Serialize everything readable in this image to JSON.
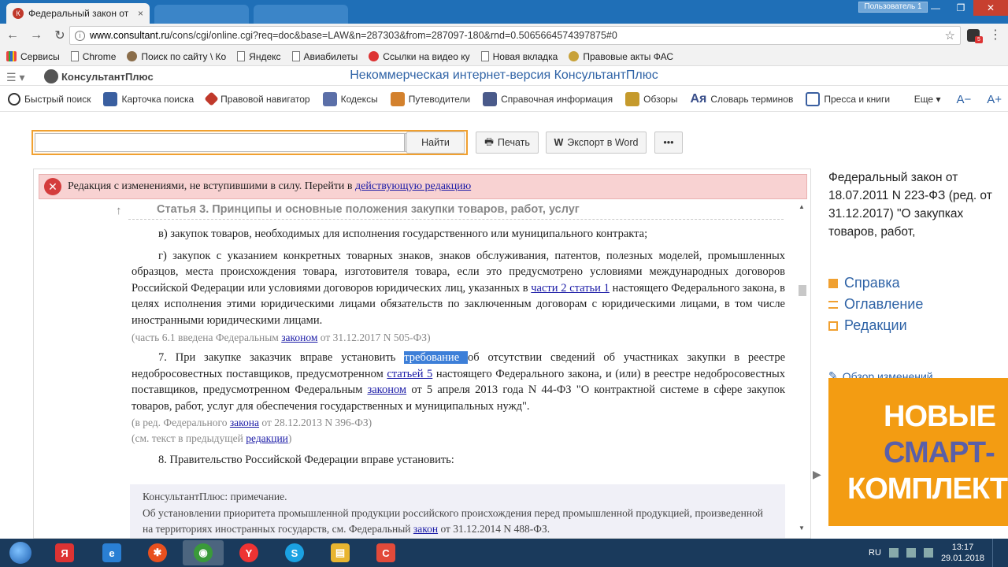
{
  "browser": {
    "tab_title": "Федеральный закон от",
    "tab_close": "×",
    "user_label": "Пользователь 1",
    "url_prefix": "www.consultant.ru",
    "url_rest": "/cons/cgi/online.cgi?req=doc&base=LAW&n=287303&from=287097-180&rnd=0.5065664574397875#0",
    "ext_badge": "5",
    "window_buttons": {
      "minimize": "—",
      "maximize": "❐",
      "close": "✕"
    }
  },
  "bookmarks": [
    {
      "label": "Сервисы",
      "icon": "apps-icon"
    },
    {
      "label": "Chrome",
      "icon": "page-icon"
    },
    {
      "label": "Поиск по сайту \\ Ко",
      "icon": "globe-icon"
    },
    {
      "label": "Яндекс",
      "icon": "page-icon"
    },
    {
      "label": "Авиабилеты",
      "icon": "page-icon"
    },
    {
      "label": "Ссылки на видео ку",
      "icon": "flower-icon"
    },
    {
      "label": "Новая вкладка",
      "icon": "page-icon"
    },
    {
      "label": "Правовые акты ФАС",
      "icon": "fas-icon"
    }
  ],
  "header": {
    "logo_text": "КонсультантПлюс",
    "site_title": "Некоммерческая интернет-версия КонсультантПлюс"
  },
  "nav": {
    "items": [
      "Быстрый поиск",
      "Карточка поиска",
      "Правовой навигатор",
      "Кодексы",
      "Путеводители",
      "Справочная информация",
      "Обзоры",
      "Словарь терминов",
      "Пресса и книги"
    ],
    "dict_icon": "Ая",
    "more": "Еще ▾",
    "font_smaller": "A−",
    "font_larger": "A+"
  },
  "search": {
    "placeholder": "",
    "find_button": "Найти",
    "print_button": "Печать",
    "export_button": "Экспорт в Word",
    "more_button": "•••"
  },
  "document": {
    "warning_text": "Редакция с изменениями, не вступившими в силу. Перейти в ",
    "warning_link": "действующую редакцию",
    "article_heading": "Статья 3. Принципы и основные положения закупки товаров, работ, услуг",
    "p_v": "в) закупок товаров, необходимых для исполнения государственного или муниципального контракта;",
    "p_g_1": "г) закупок с указанием конкретных товарных знаков, знаков обслуживания, патентов, полезных моделей, промышленных образцов, места происхождения товара, изготовителя товара, если это предусмотрено условиями международных договоров Российской Федерации или условиями договоров юридических лиц, указанных в ",
    "p_g_link": "части 2 статьи 1",
    "p_g_2": " настоящего Федерального закона, в целях исполнения этими юридическими лицами обязательств по заключенным договорам с юридическими лицами, в том числе иностранными юридическими лицами.",
    "note_61_pre": "(часть 6.1 введена Федеральным ",
    "note_61_link": "законом",
    "note_61_post": " от 31.12.2017 N 505-ФЗ)",
    "p7_pre": "7. При закупке заказчик вправе установить ",
    "p7_hl": "требование ",
    "p7_mid": "об отсутствии сведений об участниках закупки в реестре недобросовестных поставщиков, предусмотренном ",
    "p7_link1": "статьей 5",
    "p7_mid2": " настоящего Федерального закона, и (или) в реестре недобросовестных поставщиков, предусмотренном Федеральным ",
    "p7_link2": "законом",
    "p7_post": " от 5 апреля 2013 года N 44-ФЗ \"О контрактной системе в сфере закупок товаров, работ, услуг для обеспечения государственных и муниципальных нужд\".",
    "note_red_pre": "(в ред. Федерального ",
    "note_red_link": "закона",
    "note_red_post": " от 28.12.2013 N 396-ФЗ)",
    "note_prev_pre": "(см. текст в предыдущей ",
    "note_prev_link": "редакции",
    "note_prev_post": ")",
    "p8": "8. Правительство Российской Федерации вправе установить:",
    "cp_note_title": "КонсультантПлюс: примечание.",
    "cp_note_1": "Об установлении приоритета промышленной продукции российского происхождения перед промышленной продукцией, произведенной на территориях иностранных государств, см. Федеральный ",
    "cp_note_link": "закон",
    "cp_note_2": " от 31.12.2014 N 488-ФЗ."
  },
  "right_panel": {
    "doc_title": "Федеральный закон от 18.07.2011 N 223-ФЗ (ред. от 31.12.2017) \"О закупках товаров, работ,",
    "links": [
      "Справка",
      "Оглавление",
      "Редакции"
    ],
    "changes_link": "Обзор изменений",
    "ad_line1": "НОВЫЕ",
    "ad_line2": "СМАРТ-",
    "ad_line3": "КОМПЛЕКТЫ"
  },
  "taskbar": {
    "apps": [
      {
        "name": "yandex-browser",
        "glyph": "Я",
        "color": "#d33"
      },
      {
        "name": "internet-explorer",
        "glyph": "e",
        "color": "#2a7fd4"
      },
      {
        "name": "app-orange",
        "glyph": "✱",
        "color": "#e8501e"
      },
      {
        "name": "chrome",
        "glyph": "◉",
        "color": "#3a9a3a"
      },
      {
        "name": "yandex",
        "glyph": "Y",
        "color": "#e33"
      },
      {
        "name": "skype",
        "glyph": "S",
        "color": "#1ba1e2"
      },
      {
        "name": "explorer",
        "glyph": "▤",
        "color": "#e8b530"
      },
      {
        "name": "app-red",
        "glyph": "C",
        "color": "#e24a3a"
      }
    ],
    "lang": "RU",
    "time": "13:17",
    "date": "29.01.2018"
  }
}
